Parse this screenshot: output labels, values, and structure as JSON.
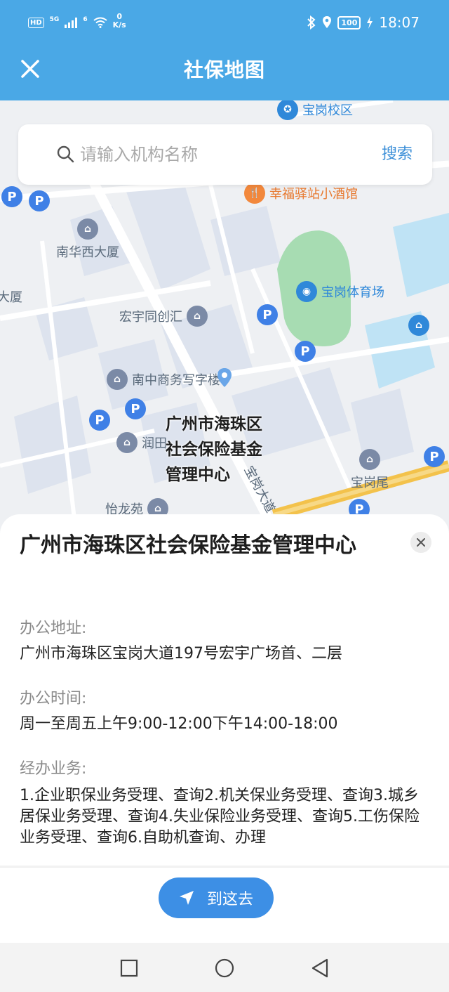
{
  "status_bar": {
    "left_badge": "HD",
    "network": "5G",
    "wifi_gen": "6",
    "speed_value": "0",
    "speed_unit": "K/s",
    "battery": "100",
    "time": "18:07"
  },
  "app_bar": {
    "title": "社保地图",
    "close_icon": "close-icon"
  },
  "search": {
    "placeholder": "请输入机构名称",
    "button": "搜索"
  },
  "map": {
    "pois": [
      {
        "id": "school",
        "text": "宝岗校区",
        "icon": "school-icon"
      },
      {
        "id": "hotel",
        "text": "幸福驿站小酒馆",
        "icon": "food-icon"
      },
      {
        "id": "nanhua",
        "text": "南华西大厦",
        "icon": "building-icon"
      },
      {
        "id": "dasha",
        "text": "大厦",
        "icon": "building-icon"
      },
      {
        "id": "hongyu",
        "text": "宏宇同创汇",
        "icon": "building-icon"
      },
      {
        "id": "stadium",
        "text": "宝岗体育场",
        "icon": "stadium-icon"
      },
      {
        "id": "nanzhong",
        "text": "南中商务写字楼",
        "icon": "office-icon"
      },
      {
        "id": "runtian",
        "text": "润田",
        "icon": "building-icon"
      },
      {
        "id": "baogangwei",
        "text": "宝岗尾",
        "icon": "building-icon"
      },
      {
        "id": "yilong",
        "text": "怡龙苑",
        "icon": "building-icon"
      },
      {
        "id": "road",
        "text": "宝岗大道",
        "icon": "road-label"
      }
    ],
    "selected_label_lines": [
      "广州市海珠区",
      "社会保险基金",
      "管理中心"
    ],
    "parking_symbol": "P",
    "colors": {
      "park_green": "#a7dcb2",
      "water_blue": "#bfe3f5",
      "road_yellow": "#f3c24b"
    }
  },
  "detail": {
    "title": "广州市海珠区社会保险基金管理中心",
    "address_label": "办公地址:",
    "address_value": "广州市海珠区宝岗大道197号宏宇广场首、二层",
    "hours_label": "办公时间:",
    "hours_value": "周一至周五上午9:00-12:00下午14:00-18:00",
    "services_label": "经办业务:",
    "services_value": "1.企业职保业务受理、查询2.机关保业务受理、查询3.城乡居保业务受理、查询4.失业保险业务受理、查询5.工伤保险业务受理、查询6.自助机查询、办理",
    "close_icon": "close-icon"
  },
  "actions": {
    "navigate_button": "到这去",
    "navigate_icon": "navigation-arrow-icon",
    "accent": "#3d8fe5"
  },
  "nav_bar": {
    "recent": "square-icon",
    "home": "circle-icon",
    "back": "triangle-back-icon"
  }
}
